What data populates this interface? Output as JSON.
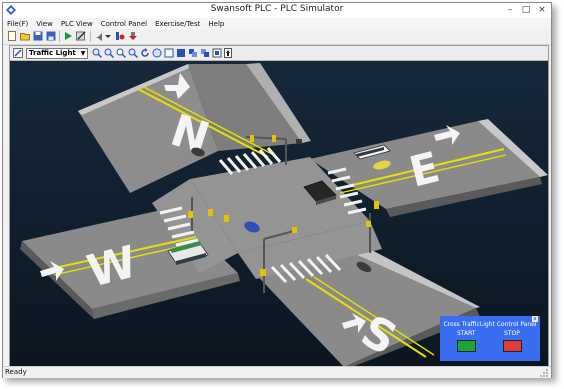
{
  "window": {
    "title": "Swansoft PLC - PLC Simulator",
    "minimize": "–",
    "maximize": "□",
    "close": "×"
  },
  "menu": [
    {
      "label": "File(F)"
    },
    {
      "label": "View"
    },
    {
      "label": "PLC View"
    },
    {
      "label": "Control Panel"
    },
    {
      "label": "Exercise/Test"
    },
    {
      "label": "Help"
    }
  ],
  "scene": {
    "selected": "Traffic Light",
    "arrow": "▼"
  },
  "road_letters": {
    "north": "N",
    "east": "E",
    "west": "W",
    "south": "S"
  },
  "status": {
    "text": "Ready"
  },
  "control_panel": {
    "title": "Cross TrafficLight Control Panel",
    "close": "x",
    "start_label": "START",
    "stop_label": "STOP",
    "start_color": "#1aa53a",
    "stop_color": "#e03c3c"
  },
  "colors": {
    "accent": "#3a6ef0",
    "road": "#808080",
    "lane_line": "#e8e000",
    "background": "#101f2c"
  }
}
